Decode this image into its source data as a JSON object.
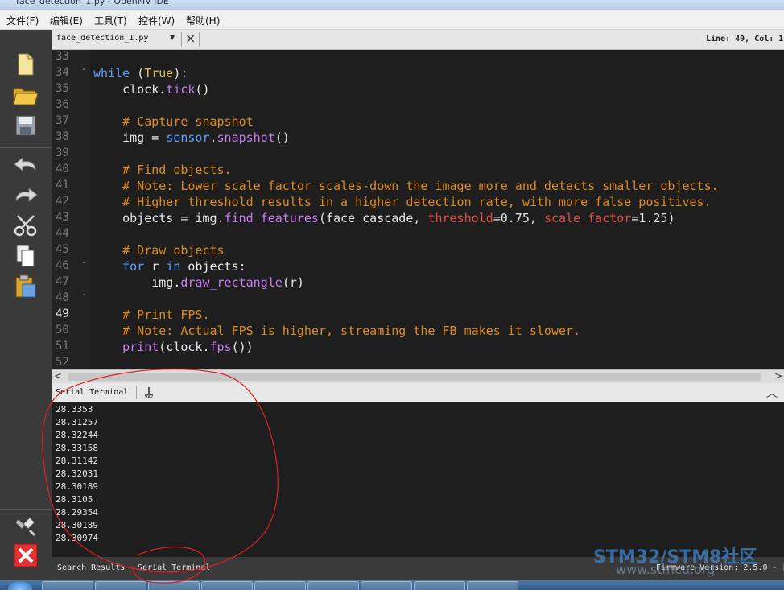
{
  "window": {
    "title": "face_detection_1.py - OpenMV IDE"
  },
  "menu": [
    {
      "label": "文件(F)"
    },
    {
      "label": "编辑(E)"
    },
    {
      "label": "工具(T)"
    },
    {
      "label": "控件(W)"
    },
    {
      "label": "帮助(H)"
    }
  ],
  "toolbar": {
    "buttons": [
      "new-file-icon",
      "open-folder-icon",
      "save-icon",
      "undo-icon",
      "redo-icon",
      "cut-icon",
      "copy-icon",
      "paste-icon"
    ],
    "bottom_buttons": [
      "connect-icon",
      "disconnect-icon"
    ]
  },
  "editor": {
    "filename": "face_detection_1.py",
    "cursor_position": "Line: 49, Col: 1",
    "current_line": 49,
    "lines": [
      {
        "num": "33",
        "text": ""
      },
      {
        "num": "34",
        "text": "while (True):"
      },
      {
        "num": "35",
        "text": "    clock.tick()"
      },
      {
        "num": "36",
        "text": ""
      },
      {
        "num": "37",
        "text": "    # Capture snapshot"
      },
      {
        "num": "38",
        "text": "    img = sensor.snapshot()"
      },
      {
        "num": "39",
        "text": ""
      },
      {
        "num": "40",
        "text": "    # Find objects."
      },
      {
        "num": "41",
        "text": "    # Note: Lower scale factor scales-down the image more and detects smaller objects."
      },
      {
        "num": "42",
        "text": "    # Higher threshold results in a higher detection rate, with more false positives."
      },
      {
        "num": "43",
        "text": "    objects = img.find_features(face_cascade, threshold=0.75, scale_factor=1.25)"
      },
      {
        "num": "44",
        "text": ""
      },
      {
        "num": "45",
        "text": "    # Draw objects"
      },
      {
        "num": "46",
        "text": "    for r in objects:"
      },
      {
        "num": "47",
        "text": "        img.draw_rectangle(r)"
      },
      {
        "num": "48",
        "text": ""
      },
      {
        "num": "49",
        "text": "    # Print FPS."
      },
      {
        "num": "50",
        "text": "    # Note: Actual FPS is higher, streaming the FB makes it slower."
      },
      {
        "num": "51",
        "text": "    print(clock.fps())"
      },
      {
        "num": "52",
        "text": ""
      }
    ]
  },
  "terminal": {
    "title": "Serial Terminal",
    "output": [
      "28.3353",
      "28.31257",
      "28.32244",
      "28.33158",
      "28.31142",
      "28.32031",
      "28.30189",
      "28.3105",
      "28.29354",
      "28.30189",
      "28.30974"
    ]
  },
  "bottom": {
    "tabs": [
      "Search Results",
      "Serial Terminal"
    ],
    "firmware": "Firmware Version: 2.5.0 - [",
    "watermark_title": "STM32/STM8社区",
    "watermark_url": "www.stmcu.org"
  },
  "colors": {
    "keyword": "#5ea0ff",
    "comment": "#e08b1e",
    "function": "#c77df3",
    "argument": "#e34b42",
    "annotation": "#e02020"
  }
}
